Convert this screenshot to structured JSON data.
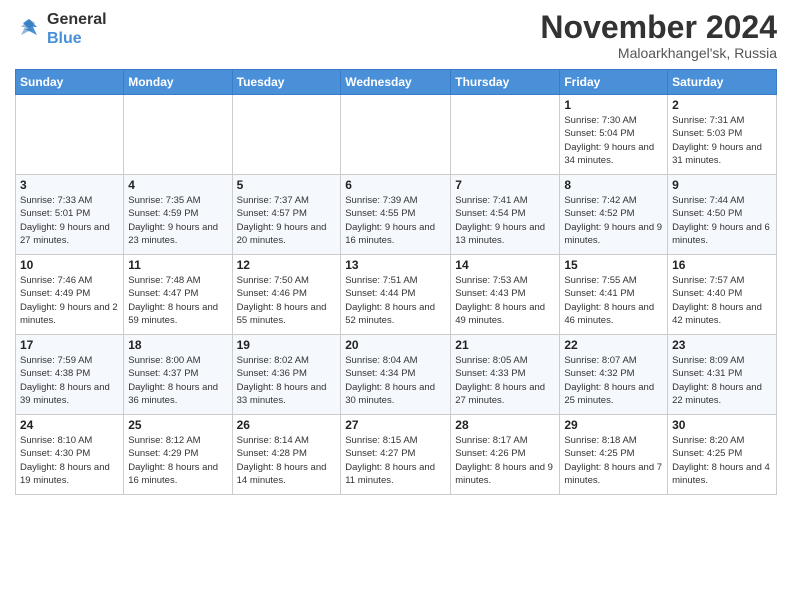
{
  "header": {
    "logo_line1": "General",
    "logo_line2": "Blue",
    "month": "November 2024",
    "location": "Maloarkhangel'sk, Russia"
  },
  "weekdays": [
    "Sunday",
    "Monday",
    "Tuesday",
    "Wednesday",
    "Thursday",
    "Friday",
    "Saturday"
  ],
  "weeks": [
    [
      {
        "day": "",
        "info": ""
      },
      {
        "day": "",
        "info": ""
      },
      {
        "day": "",
        "info": ""
      },
      {
        "day": "",
        "info": ""
      },
      {
        "day": "",
        "info": ""
      },
      {
        "day": "1",
        "info": "Sunrise: 7:30 AM\nSunset: 5:04 PM\nDaylight: 9 hours and 34 minutes."
      },
      {
        "day": "2",
        "info": "Sunrise: 7:31 AM\nSunset: 5:03 PM\nDaylight: 9 hours and 31 minutes."
      }
    ],
    [
      {
        "day": "3",
        "info": "Sunrise: 7:33 AM\nSunset: 5:01 PM\nDaylight: 9 hours and 27 minutes."
      },
      {
        "day": "4",
        "info": "Sunrise: 7:35 AM\nSunset: 4:59 PM\nDaylight: 9 hours and 23 minutes."
      },
      {
        "day": "5",
        "info": "Sunrise: 7:37 AM\nSunset: 4:57 PM\nDaylight: 9 hours and 20 minutes."
      },
      {
        "day": "6",
        "info": "Sunrise: 7:39 AM\nSunset: 4:55 PM\nDaylight: 9 hours and 16 minutes."
      },
      {
        "day": "7",
        "info": "Sunrise: 7:41 AM\nSunset: 4:54 PM\nDaylight: 9 hours and 13 minutes."
      },
      {
        "day": "8",
        "info": "Sunrise: 7:42 AM\nSunset: 4:52 PM\nDaylight: 9 hours and 9 minutes."
      },
      {
        "day": "9",
        "info": "Sunrise: 7:44 AM\nSunset: 4:50 PM\nDaylight: 9 hours and 6 minutes."
      }
    ],
    [
      {
        "day": "10",
        "info": "Sunrise: 7:46 AM\nSunset: 4:49 PM\nDaylight: 9 hours and 2 minutes."
      },
      {
        "day": "11",
        "info": "Sunrise: 7:48 AM\nSunset: 4:47 PM\nDaylight: 8 hours and 59 minutes."
      },
      {
        "day": "12",
        "info": "Sunrise: 7:50 AM\nSunset: 4:46 PM\nDaylight: 8 hours and 55 minutes."
      },
      {
        "day": "13",
        "info": "Sunrise: 7:51 AM\nSunset: 4:44 PM\nDaylight: 8 hours and 52 minutes."
      },
      {
        "day": "14",
        "info": "Sunrise: 7:53 AM\nSunset: 4:43 PM\nDaylight: 8 hours and 49 minutes."
      },
      {
        "day": "15",
        "info": "Sunrise: 7:55 AM\nSunset: 4:41 PM\nDaylight: 8 hours and 46 minutes."
      },
      {
        "day": "16",
        "info": "Sunrise: 7:57 AM\nSunset: 4:40 PM\nDaylight: 8 hours and 42 minutes."
      }
    ],
    [
      {
        "day": "17",
        "info": "Sunrise: 7:59 AM\nSunset: 4:38 PM\nDaylight: 8 hours and 39 minutes."
      },
      {
        "day": "18",
        "info": "Sunrise: 8:00 AM\nSunset: 4:37 PM\nDaylight: 8 hours and 36 minutes."
      },
      {
        "day": "19",
        "info": "Sunrise: 8:02 AM\nSunset: 4:36 PM\nDaylight: 8 hours and 33 minutes."
      },
      {
        "day": "20",
        "info": "Sunrise: 8:04 AM\nSunset: 4:34 PM\nDaylight: 8 hours and 30 minutes."
      },
      {
        "day": "21",
        "info": "Sunrise: 8:05 AM\nSunset: 4:33 PM\nDaylight: 8 hours and 27 minutes."
      },
      {
        "day": "22",
        "info": "Sunrise: 8:07 AM\nSunset: 4:32 PM\nDaylight: 8 hours and 25 minutes."
      },
      {
        "day": "23",
        "info": "Sunrise: 8:09 AM\nSunset: 4:31 PM\nDaylight: 8 hours and 22 minutes."
      }
    ],
    [
      {
        "day": "24",
        "info": "Sunrise: 8:10 AM\nSunset: 4:30 PM\nDaylight: 8 hours and 19 minutes."
      },
      {
        "day": "25",
        "info": "Sunrise: 8:12 AM\nSunset: 4:29 PM\nDaylight: 8 hours and 16 minutes."
      },
      {
        "day": "26",
        "info": "Sunrise: 8:14 AM\nSunset: 4:28 PM\nDaylight: 8 hours and 14 minutes."
      },
      {
        "day": "27",
        "info": "Sunrise: 8:15 AM\nSunset: 4:27 PM\nDaylight: 8 hours and 11 minutes."
      },
      {
        "day": "28",
        "info": "Sunrise: 8:17 AM\nSunset: 4:26 PM\nDaylight: 8 hours and 9 minutes."
      },
      {
        "day": "29",
        "info": "Sunrise: 8:18 AM\nSunset: 4:25 PM\nDaylight: 8 hours and 7 minutes."
      },
      {
        "day": "30",
        "info": "Sunrise: 8:20 AM\nSunset: 4:25 PM\nDaylight: 8 hours and 4 minutes."
      }
    ]
  ]
}
